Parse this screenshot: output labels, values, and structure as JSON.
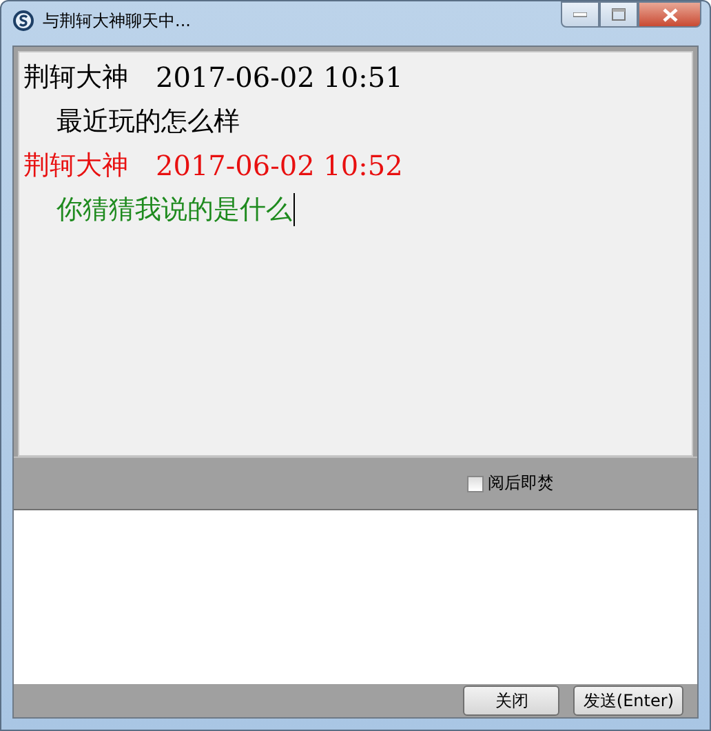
{
  "window": {
    "title": "与荆轲大神聊天中..."
  },
  "messages": [
    {
      "kind": "other",
      "sender": "荆轲大神",
      "time": "2017-06-02 10:51",
      "text": "最近玩的怎么样"
    },
    {
      "kind": "self",
      "sender": "荆轲大神",
      "time": "2017-06-02 10:52",
      "text": "你猜猜我说的是什么"
    }
  ],
  "options": {
    "burn_after_reading": {
      "label": "阅后即焚",
      "checked": false
    }
  },
  "buttons": [
    {
      "label": "关闭"
    },
    {
      "label": "发送(Enter)"
    }
  ]
}
